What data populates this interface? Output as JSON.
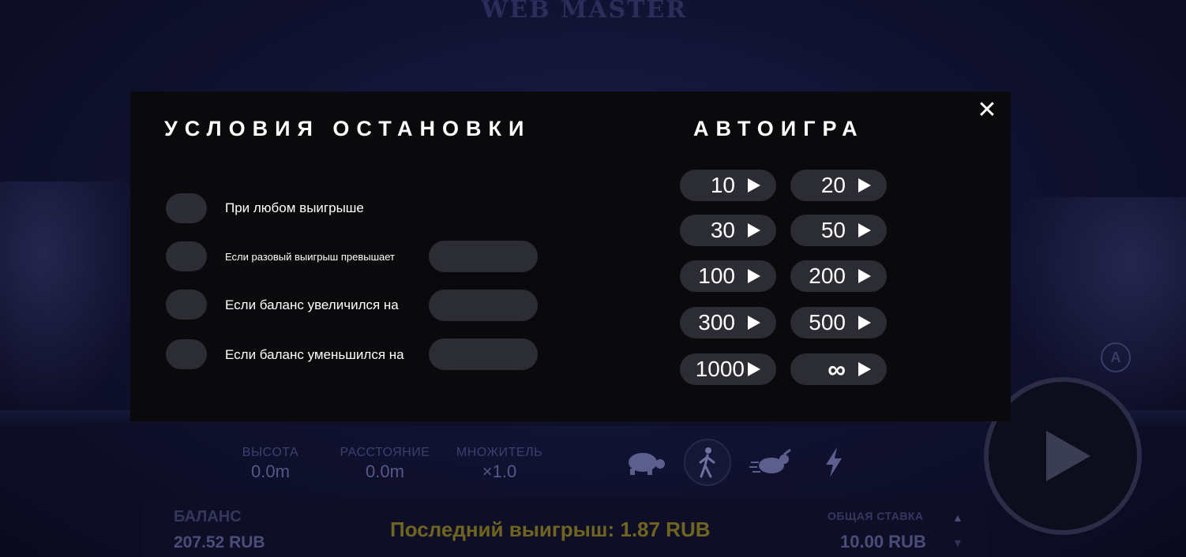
{
  "background": {
    "logo_text": "WEB MASTER",
    "stats": [
      {
        "label": "ВЫСОТА",
        "value": "0.0m"
      },
      {
        "label": "РАССТОЯНИЕ",
        "value": "0.0m"
      },
      {
        "label": "МНОЖИТЕЛЬ",
        "value": "×1.0"
      }
    ],
    "speed_icons": [
      "turtle-icon",
      "walk-icon",
      "rabbit-icon",
      "lightning-icon"
    ],
    "balance_label": "БАЛАНС",
    "balance_value": "207.52 RUB",
    "last_win": "Последний выигрыш: 1.87 RUB",
    "bet_label": "ОБЩАЯ СТАВКА",
    "bet_value": "10.00 RUB"
  },
  "modal": {
    "close_icon": "close-icon",
    "stop_conditions": {
      "title": "УСЛОВИЯ ОСТАНОВКИ",
      "items": [
        {
          "label": "При любом выигрыше",
          "has_input": false,
          "input_value": ""
        },
        {
          "label": "Если разовый выигрыш превышает",
          "has_input": true,
          "input_value": ""
        },
        {
          "label": "Если баланс увеличился на",
          "has_input": true,
          "input_value": ""
        },
        {
          "label": "Если баланс уменьшился на",
          "has_input": true,
          "input_value": ""
        }
      ]
    },
    "autoplay": {
      "title": "АВТОИГРА",
      "options": [
        "10",
        "20",
        "30",
        "50",
        "100",
        "200",
        "300",
        "500",
        "1000",
        "∞"
      ]
    }
  },
  "colors": {
    "modal_bg": "#0a0a0d",
    "control_bg": "#2c2c34",
    "text": "#ffffff"
  }
}
